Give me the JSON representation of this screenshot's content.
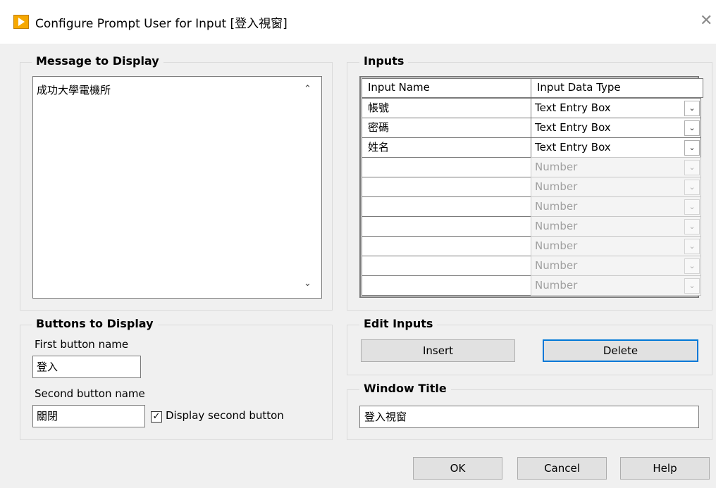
{
  "window": {
    "title": "Configure Prompt User for Input [登入視窗]",
    "close_glyph": "✕"
  },
  "message": {
    "legend": "Message to Display",
    "text": "成功大學電機所",
    "scroll_up": "⌃",
    "scroll_down": "⌄"
  },
  "buttons_group": {
    "legend": "Buttons to Display",
    "first_label": "First button name",
    "first_value": "登入",
    "second_label": "Second button name",
    "second_value": "關閉",
    "display_second_label": "Display second button",
    "display_second_checked": true,
    "check_glyph": "✓"
  },
  "inputs": {
    "legend": "Inputs",
    "col_name": "Input Name",
    "col_type": "Input Data Type",
    "dropdown_glyph": "⌄",
    "rows": [
      {
        "name": "帳號",
        "type": "Text Entry Box",
        "enabled": true
      },
      {
        "name": "密碼",
        "type": "Text Entry Box",
        "enabled": true
      },
      {
        "name": "姓名",
        "type": "Text Entry Box",
        "enabled": true
      },
      {
        "name": "",
        "type": "Number",
        "enabled": false
      },
      {
        "name": "",
        "type": "Number",
        "enabled": false
      },
      {
        "name": "",
        "type": "Number",
        "enabled": false
      },
      {
        "name": "",
        "type": "Number",
        "enabled": false
      },
      {
        "name": "",
        "type": "Number",
        "enabled": false
      },
      {
        "name": "",
        "type": "Number",
        "enabled": false
      },
      {
        "name": "",
        "type": "Number",
        "enabled": false
      }
    ]
  },
  "edit_inputs": {
    "legend": "Edit Inputs",
    "insert_label": "Insert",
    "delete_label": "Delete"
  },
  "window_title_group": {
    "legend": "Window Title",
    "value": "登入視窗"
  },
  "footer": {
    "ok_label": "OK",
    "cancel_label": "Cancel",
    "help_label": "Help"
  }
}
